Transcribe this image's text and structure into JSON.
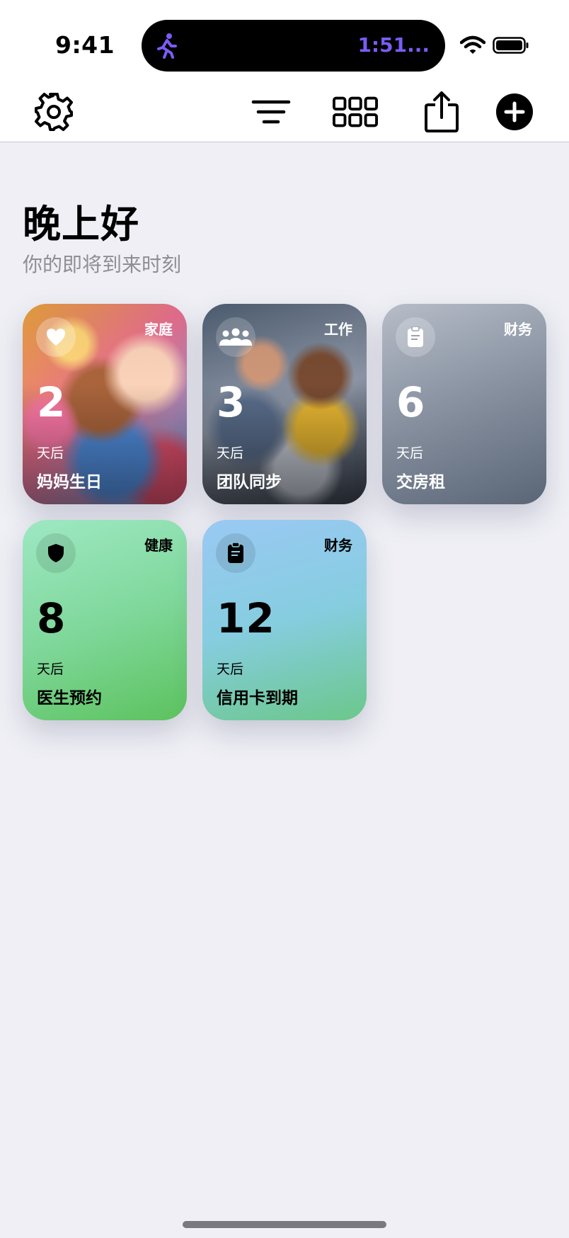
{
  "status_bar": {
    "time": "9:41",
    "activity_timer": "1:51..."
  },
  "toolbar": {
    "buttons": [
      "gear-icon",
      "sort-icon",
      "grid-icon",
      "share-icon",
      "plus-icon"
    ]
  },
  "header": {
    "greeting": "晚上好",
    "subtitle": "你的即将到来时刻"
  },
  "cards": [
    {
      "category": "家庭",
      "number": "2",
      "unit": "天后",
      "title": "妈妈生日",
      "icon": "heart-icon",
      "theme": "photo"
    },
    {
      "category": "工作",
      "number": "3",
      "unit": "天后",
      "title": "团队同步",
      "icon": "people-icon",
      "theme": "photo"
    },
    {
      "category": "财务",
      "number": "6",
      "unit": "天后",
      "title": "交房租",
      "icon": "clipboard-icon",
      "color": "#8a94a3"
    },
    {
      "category": "健康",
      "number": "8",
      "unit": "天后",
      "title": "医生预约",
      "icon": "shield-icon",
      "color": "#7fd89a"
    },
    {
      "category": "财务",
      "number": "12",
      "unit": "天后",
      "title": "信用卡到期",
      "icon": "clipboard-icon",
      "color": "#8ccfe0"
    }
  ]
}
